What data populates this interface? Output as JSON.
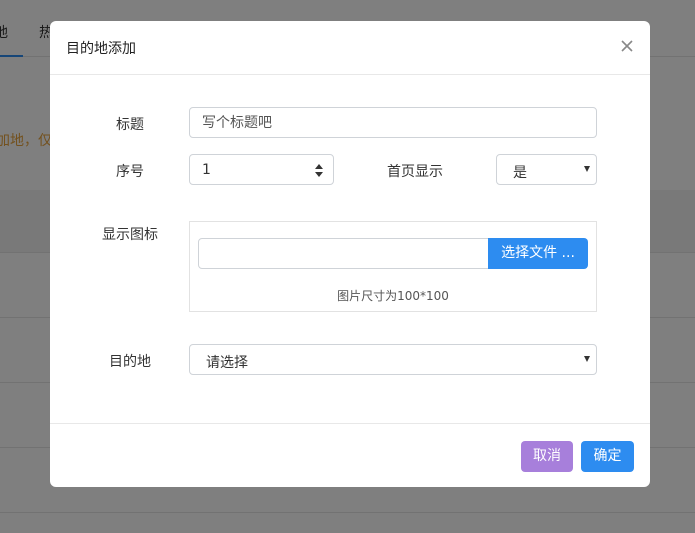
{
  "background": {
    "tabs": [
      {
        "label": "地"
      },
      {
        "label": "热"
      }
    ],
    "tip_text": "加地，仅首"
  },
  "modal": {
    "title": "目的地添加",
    "form": {
      "title_label": "标题",
      "title_placeholder": "写个标题吧",
      "title_value": "",
      "order_label": "序号",
      "order_value": "1",
      "home_display_label": "首页显示",
      "home_display_value": "是",
      "icon_label": "显示图标",
      "file_button_label": "选择文件 ...",
      "file_value": "",
      "upload_hint": "图片尺寸为100*100",
      "destination_label": "目的地",
      "destination_value": "请选择"
    },
    "footer": {
      "cancel_label": "取消",
      "ok_label": "确定"
    }
  },
  "colors": {
    "primary": "#2d8cf0",
    "cancel": "#a77fdb",
    "tip": "#e6a23c",
    "overlay": "rgba(0,0,0,0.5)"
  },
  "icons": {
    "close": "close-icon",
    "spin": "spin-arrows-icon",
    "dropdown": "caret-down-icon"
  }
}
